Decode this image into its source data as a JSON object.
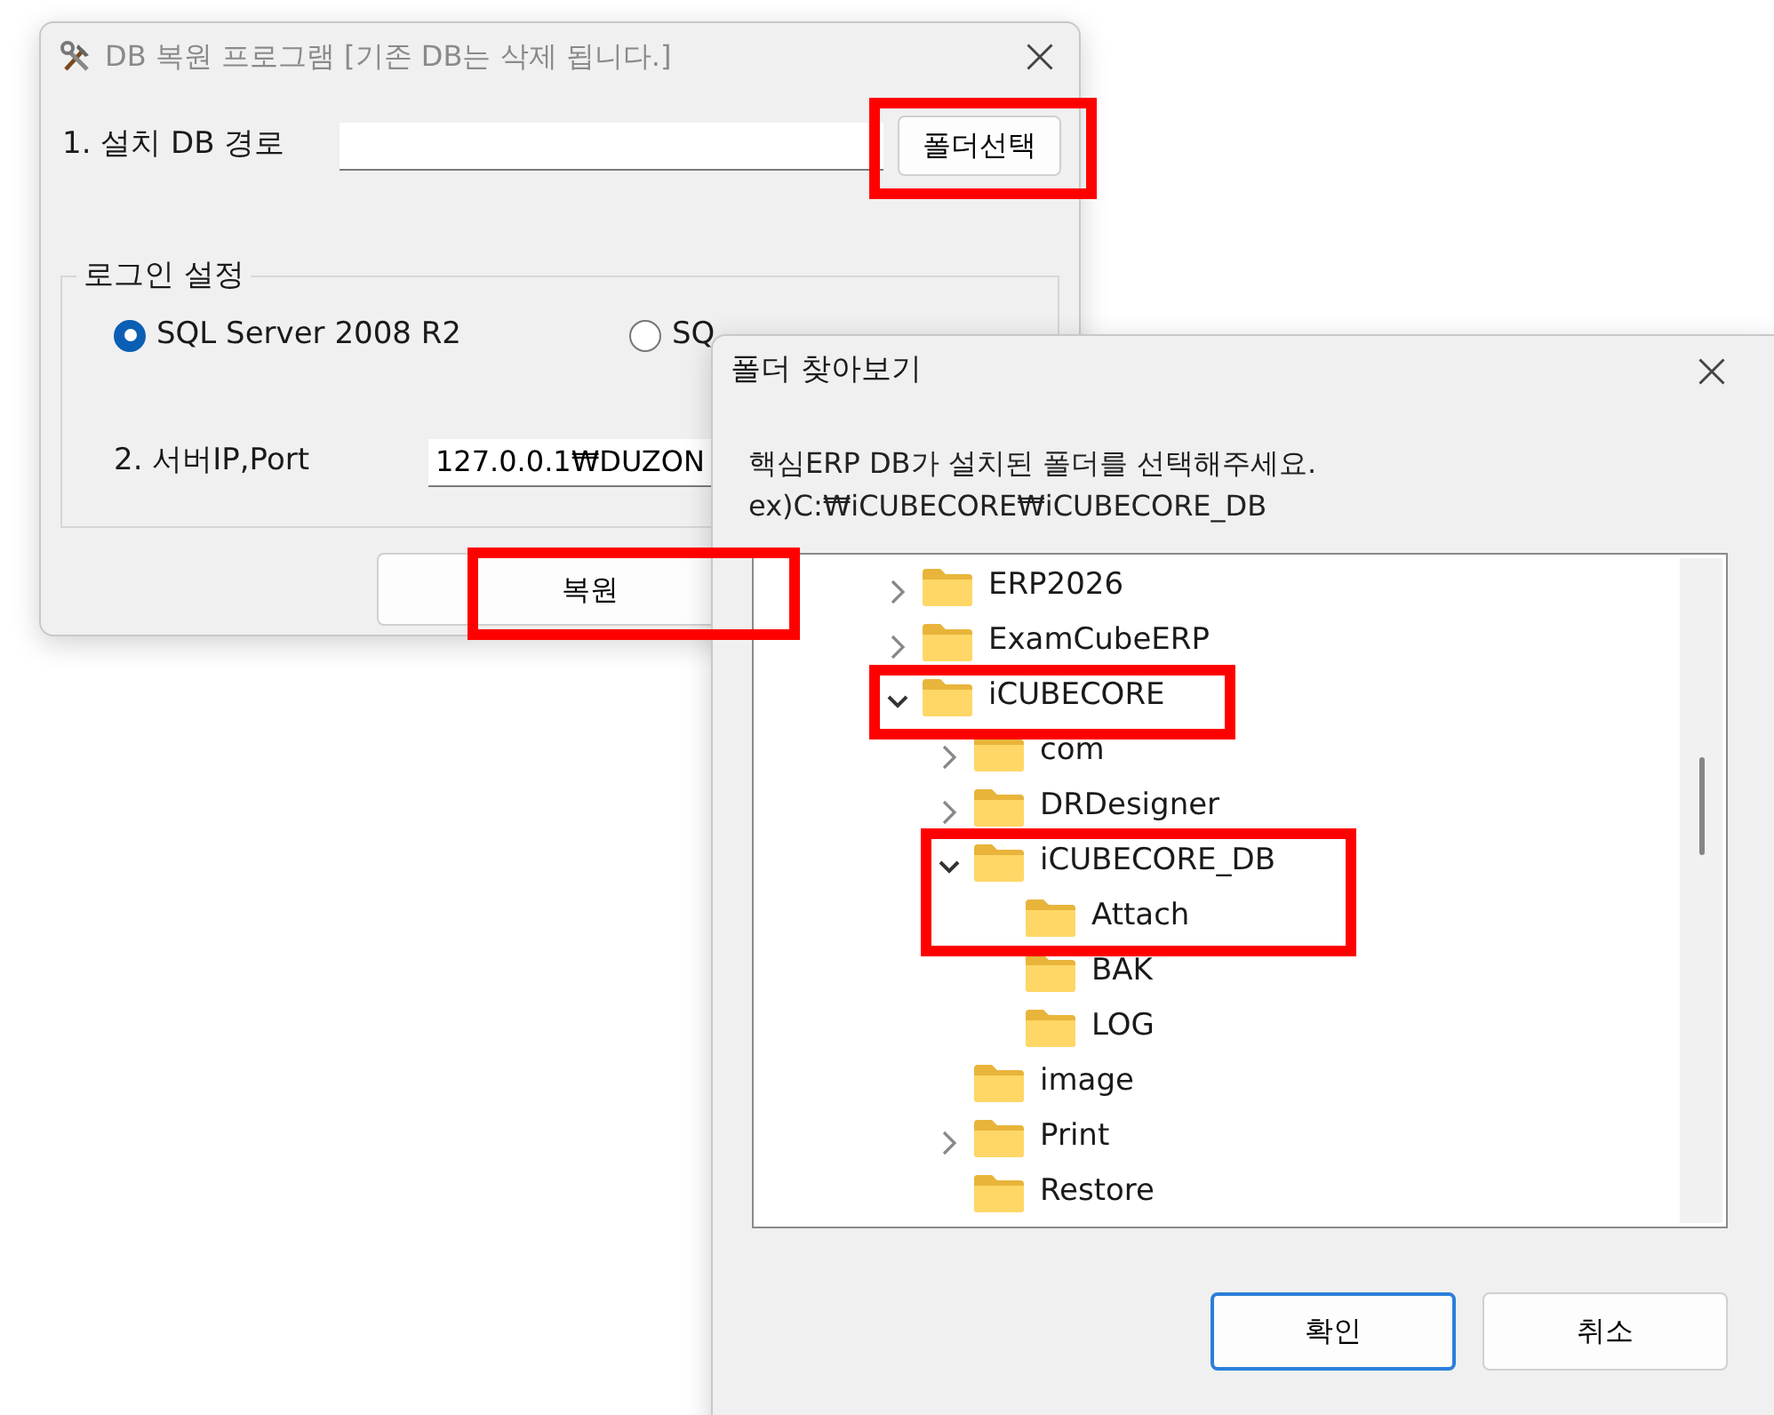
{
  "restore_window": {
    "title": "DB 복원 프로그램 [기존 DB는 삭제 됩니다.]",
    "path_label": "1. 설치 DB 경로",
    "browse_button": "폴더선택",
    "login_group": "로그인 설정",
    "radios": [
      {
        "label": "SQL Server 2008 R2",
        "selected": true
      },
      {
        "label": "SQ",
        "selected": false
      }
    ],
    "server_label": "2. 서버IP,Port",
    "server_value": "127.0.0.1₩DUZON",
    "restore_button": "복원"
  },
  "browse_dialog": {
    "title": "폴더 찾아보기",
    "instructions": [
      "핵심ERP DB가 설치된 폴더를 선택해주세요.",
      "ex)C:₩iCUBECORE₩iCUBECORE_DB"
    ],
    "tree": [
      {
        "label": "ERP2026",
        "expanded": false
      },
      {
        "label": "ExamCubeERP",
        "expanded": false
      },
      {
        "label": "iCUBECORE",
        "expanded": true,
        "children": [
          {
            "label": "com",
            "expanded": false
          },
          {
            "label": "DRDesigner",
            "expanded": false
          },
          {
            "label": "iCUBECORE_DB",
            "expanded": true,
            "children": [
              {
                "label": "Attach"
              },
              {
                "label": "BAK"
              },
              {
                "label": "LOG"
              }
            ]
          },
          {
            "label": "image"
          },
          {
            "label": "Print",
            "expanded": false
          },
          {
            "label": "Restore"
          }
        ]
      }
    ],
    "buttons": [
      {
        "label": "확인",
        "kind": "default"
      },
      {
        "label": "취소",
        "kind": "normal"
      }
    ]
  }
}
